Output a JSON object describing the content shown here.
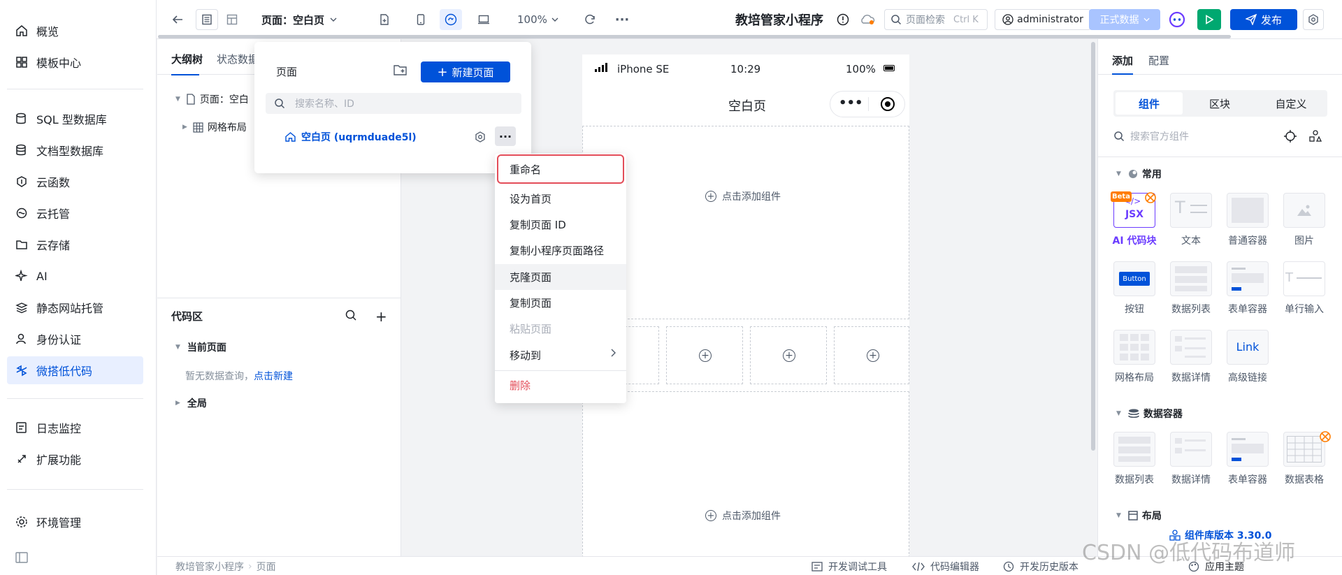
{
  "sidebar": {
    "items": [
      {
        "label": "概览",
        "icon": "home-icon"
      },
      {
        "label": "模板中心",
        "icon": "grid-icon"
      },
      {
        "label": "SQL 型数据库",
        "icon": "database-icon"
      },
      {
        "label": "文档型数据库",
        "icon": "document-database-icon"
      },
      {
        "label": "云函数",
        "icon": "function-icon"
      },
      {
        "label": "云托管",
        "icon": "cloud-hosting-icon"
      },
      {
        "label": "云存储",
        "icon": "folder-icon"
      },
      {
        "label": "AI",
        "icon": "sparkle-icon"
      },
      {
        "label": "静态网站托管",
        "icon": "layers-icon"
      },
      {
        "label": "身份认证",
        "icon": "user-icon"
      },
      {
        "label": "微搭低代码",
        "icon": "lowcode-icon"
      },
      {
        "label": "日志监控",
        "icon": "log-icon"
      },
      {
        "label": "扩展功能",
        "icon": "extension-icon"
      },
      {
        "label": "环境管理",
        "icon": "settings-icon"
      }
    ]
  },
  "toolbar": {
    "page_label": "页面：空白页",
    "zoom": "100%",
    "app_name": "教培管家小程序",
    "search_label": "页面检索",
    "search_shortcut": "Ctrl K",
    "user": "administrator",
    "env": "正式数据",
    "publish": "发布"
  },
  "outline": {
    "tabs": [
      "大纲树",
      "状态数据"
    ],
    "tree": [
      "页面：空白",
      "网格布局"
    ],
    "code_title": "代码区",
    "current_page": "当前页面",
    "empty_text": "暂无数据查询，",
    "create_link": "点击新建",
    "global": "全局"
  },
  "page_popup": {
    "title": "页面",
    "new_button": "新建页面",
    "search_placeholder": "搜索名称、ID",
    "page_name": "空白页 (uqrmduade5l)"
  },
  "context_menu": {
    "items": [
      "重命名",
      "设为首页",
      "复制页面 ID",
      "复制小程序页面路径",
      "克隆页面",
      "复制页面",
      "粘贴页面",
      "移动到",
      "删除"
    ]
  },
  "phone": {
    "device": "iPhone SE",
    "time": "10:29",
    "battery": "100%",
    "page_title": "空白页",
    "add_component": "点击添加组件"
  },
  "right_panel": {
    "tabs": [
      "添加",
      "配置"
    ],
    "segments": [
      "组件",
      "区块",
      "自定义"
    ],
    "search_placeholder": "搜索官方组件",
    "groups": [
      {
        "title": "常用",
        "items": [
          "AI 代码块",
          "文本",
          "普通容器",
          "图片",
          "按钮",
          "数据列表",
          "表单容器",
          "单行输入",
          "网格布局",
          "数据详情",
          "高级链接"
        ]
      },
      {
        "title": "数据容器",
        "items": [
          "数据列表",
          "数据详情",
          "表单容器",
          "数据表格"
        ]
      },
      {
        "title": "布局"
      }
    ],
    "beta": "Beta",
    "jsx": "JSX",
    "button_thumb": "Button",
    "link_thumb": "Link",
    "lib_version": "组件库版本 3.30.0",
    "theme": "应用主题"
  },
  "bottom": {
    "breadcrumb": [
      "教培管家小程序",
      "页面"
    ],
    "dev_tools": "开发调试工具",
    "code_editor": "代码编辑器",
    "history": "开发历史版本"
  },
  "watermark": "CSDN @低代码布道师",
  "colors": {
    "primary": "#0052d9",
    "danger": "#e34d59",
    "success": "#00a870"
  }
}
